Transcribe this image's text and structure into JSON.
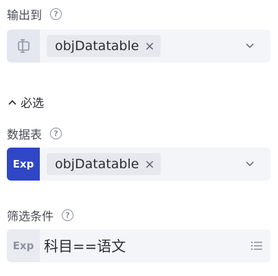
{
  "output": {
    "label": "输出到",
    "help_glyph": "?",
    "variable_icon": "variable-icon",
    "chip_value": "objDatatable",
    "chip_remove": "×"
  },
  "section": {
    "label": "必选",
    "toggle_icon": "chevron-up-icon"
  },
  "datatable": {
    "label": "数据表",
    "help_glyph": "?",
    "prefix": "Exp",
    "chip_value": "objDatatable",
    "chip_remove": "×"
  },
  "filter": {
    "label": "筛选条件",
    "help_glyph": "?",
    "prefix": "Exp",
    "value": "科目==语文",
    "list_icon": "list-icon"
  },
  "colors": {
    "exp_active": "#2f46c6",
    "field_bg": "#f4f5f8",
    "chip_bg": "#e7e8ed"
  }
}
